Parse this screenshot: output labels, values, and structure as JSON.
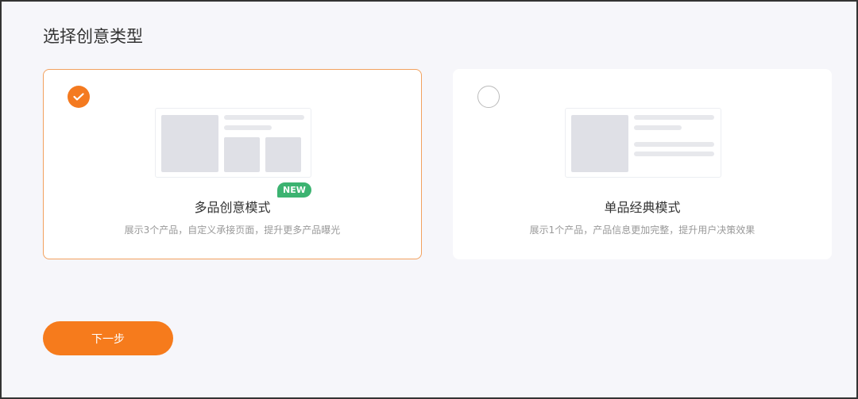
{
  "page": {
    "title": "选择创意类型"
  },
  "options": [
    {
      "name": "多品创意模式",
      "badge": "NEW",
      "desc": "展示3个产品，自定义承接页面，提升更多产品曝光",
      "selected": true
    },
    {
      "name": "单品经典模式",
      "desc": "展示1个产品，产品信息更加完整，提升用户决策效果",
      "selected": false
    }
  ],
  "actions": {
    "next_label": "下一步"
  },
  "colors": {
    "accent": "#f67b1c",
    "badge": "#3cb371",
    "background": "#f6f6fa"
  }
}
